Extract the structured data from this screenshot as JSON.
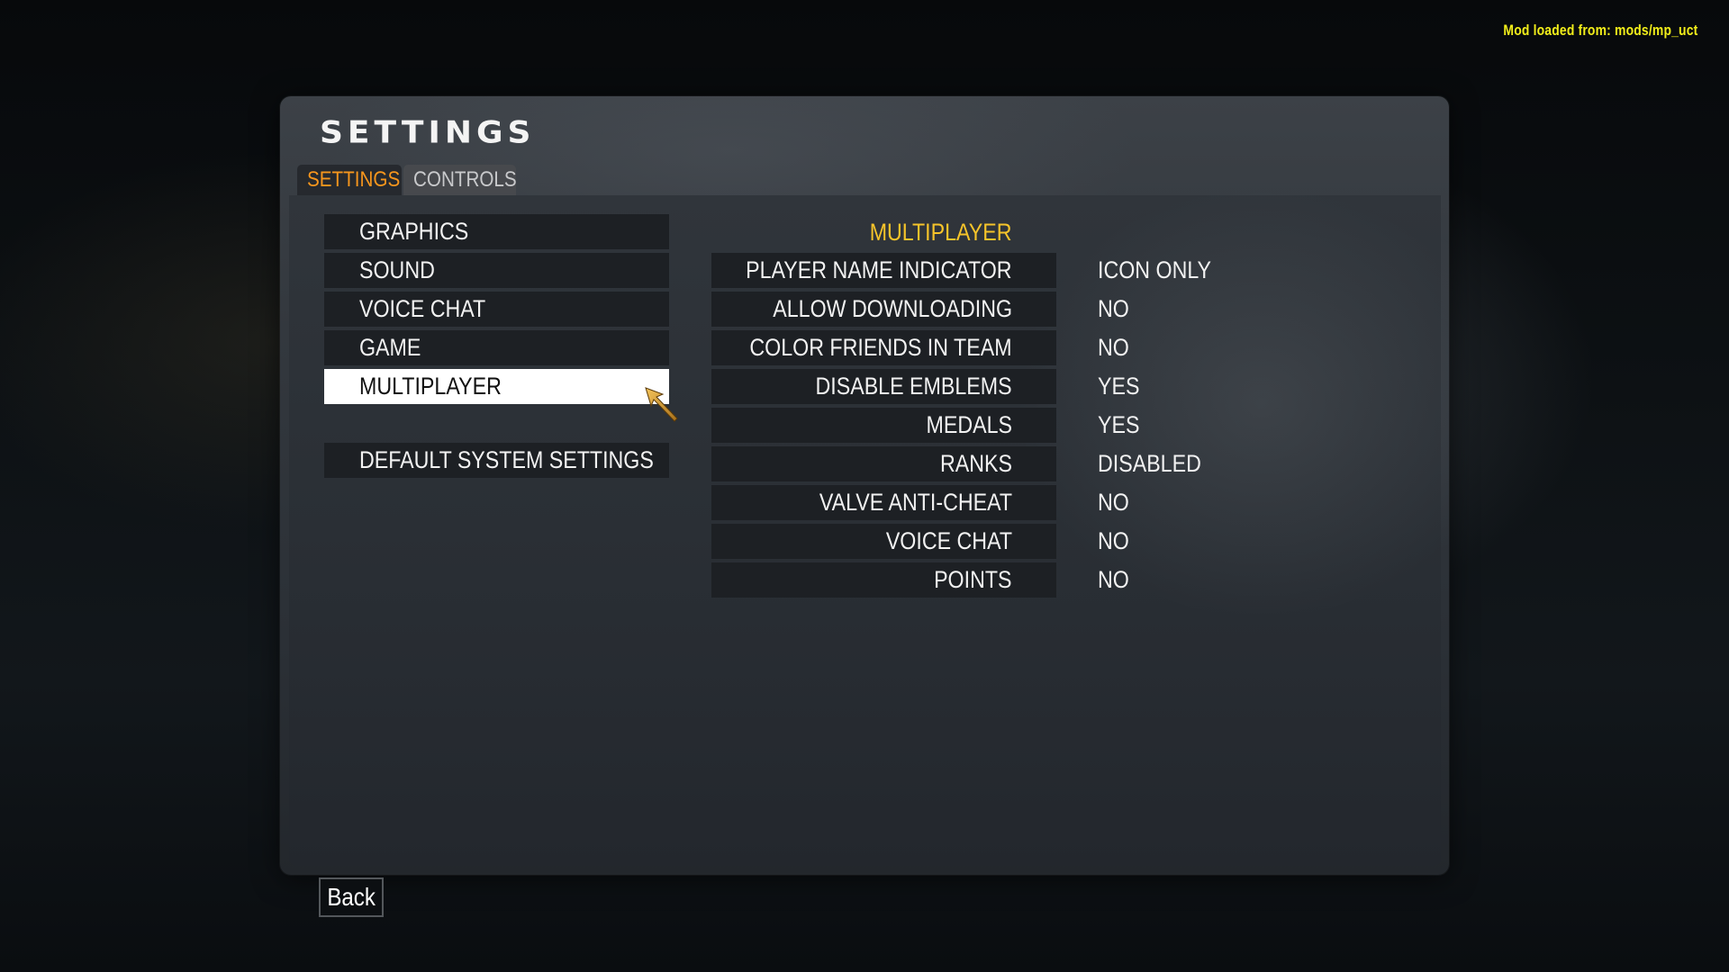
{
  "mod_notice": "Mod loaded from: mods/mp_uct",
  "panel": {
    "title": "SETTINGS",
    "tabs": [
      {
        "label": "SETTINGS",
        "active": true
      },
      {
        "label": "CONTROLS",
        "active": false
      }
    ]
  },
  "menu": {
    "items": [
      {
        "label": "GRAPHICS"
      },
      {
        "label": "SOUND"
      },
      {
        "label": "VOICE CHAT"
      },
      {
        "label": "GAME"
      },
      {
        "label": "MULTIPLAYER",
        "selected": true
      }
    ],
    "default_button": "DEFAULT SYSTEM SETTINGS"
  },
  "section": {
    "title": "MULTIPLAYER",
    "options": [
      {
        "label": "PLAYER NAME INDICATOR",
        "value": "ICON ONLY"
      },
      {
        "label": "ALLOW DOWNLOADING",
        "value": "NO"
      },
      {
        "label": "COLOR FRIENDS IN TEAM",
        "value": "NO"
      },
      {
        "label": "DISABLE EMBLEMS",
        "value": "YES"
      },
      {
        "label": "MEDALS",
        "value": "YES"
      },
      {
        "label": "RANKS",
        "value": "DISABLED"
      },
      {
        "label": "VALVE ANTI-CHEAT",
        "value": "NO"
      },
      {
        "label": "VOICE CHAT",
        "value": "NO"
      },
      {
        "label": "POINTS",
        "value": "NO"
      }
    ]
  },
  "back_button": "Back",
  "colors": {
    "tab_active": "#f7961d",
    "section_title": "#f6c42a",
    "mod_notice": "#f2ee1a",
    "selected_bg": "#ffffff"
  },
  "cursor_icon": "arrow-cursor-icon"
}
